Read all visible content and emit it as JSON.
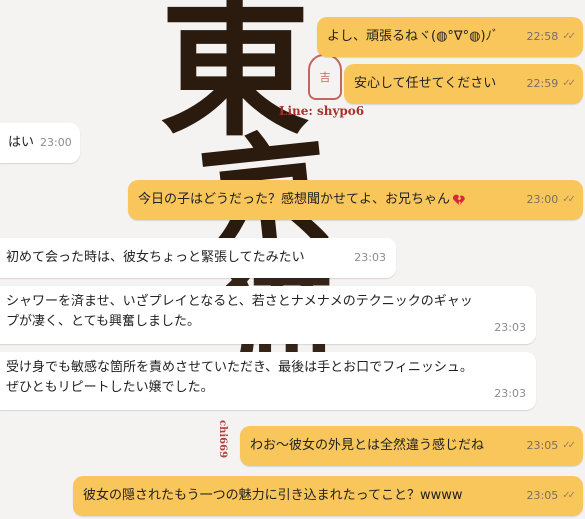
{
  "wallpaper": {
    "chars": [
      "東",
      "京",
      "猫"
    ],
    "line_text": "Line: shypo6",
    "seal_text": "吉",
    "vertical_text": "chi669"
  },
  "messages": [
    {
      "id": "m1",
      "dir": "out",
      "text": "よし、頑張るねヾ(◍°∇°◍)ﾉﾞ",
      "time": "22:58"
    },
    {
      "id": "m2",
      "dir": "out",
      "text": "安心して任せてください",
      "time": "22:59"
    },
    {
      "id": "m3",
      "dir": "in",
      "text": "はい",
      "time": "23:00"
    },
    {
      "id": "m4",
      "dir": "out",
      "text": "今日の子はどうだった？感想聞かせてよ、お兄ちゃん",
      "emoji": "broken-heart-icon",
      "time": "23:00"
    },
    {
      "id": "m5",
      "dir": "in",
      "text": "初めて会った時は、彼女ちょっと緊張してたみたい",
      "time": "23:03"
    },
    {
      "id": "m6",
      "dir": "in",
      "text": "シャワーを済ませ、いざプレイとなると、若さとナメナメのテクニックのギャップが凄く、とても興奮しました。",
      "time": "23:03"
    },
    {
      "id": "m7",
      "dir": "in",
      "text": "受け身でも敏感な箇所を責めさせていただき、最後は手とお口でフィニッシュ。ぜひともリピートしたい嬢でした。",
      "time": "23:03"
    },
    {
      "id": "m8",
      "dir": "out",
      "text": "わお～彼女の外見とは全然違う感じだね",
      "time": "23:05"
    },
    {
      "id": "m9",
      "dir": "out",
      "text": "彼女の隠されたもう一つの魅力に引き込まれたってこと？wwww",
      "time": "23:05"
    }
  ],
  "colors": {
    "outgoing": "#f8c65a",
    "incoming": "#ffffff",
    "background": "#f4f3f1"
  }
}
